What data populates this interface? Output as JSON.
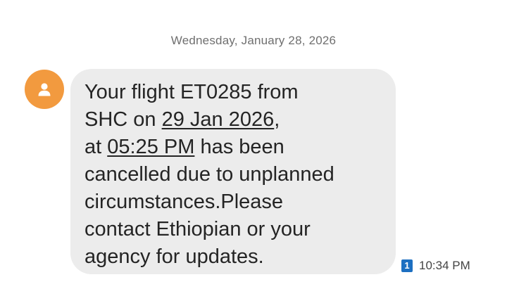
{
  "conversation": {
    "date_header": "Wednesday, January 28, 2026"
  },
  "message": {
    "line_1": "Your flight ET0285 from",
    "line_2_prefix": "SHC on ",
    "flight_date": "29 Jan 2026",
    "line_2_suffix": ",",
    "line_3_prefix": "at ",
    "flight_time": "05:25 PM",
    "line_3_suffix": " has been",
    "line_4": "cancelled due to unplanned",
    "line_5": "circumstances.Please",
    "line_6": "contact Ethiopian or your",
    "line_7": "agency for updates.",
    "sim_slot": "1",
    "timestamp": "10:34 PM"
  },
  "icons": {
    "avatar": "person-icon"
  },
  "colors": {
    "avatar_bg": "#f29a3f",
    "bubble_bg": "#ececec",
    "sim_badge": "#1c6fc1"
  }
}
